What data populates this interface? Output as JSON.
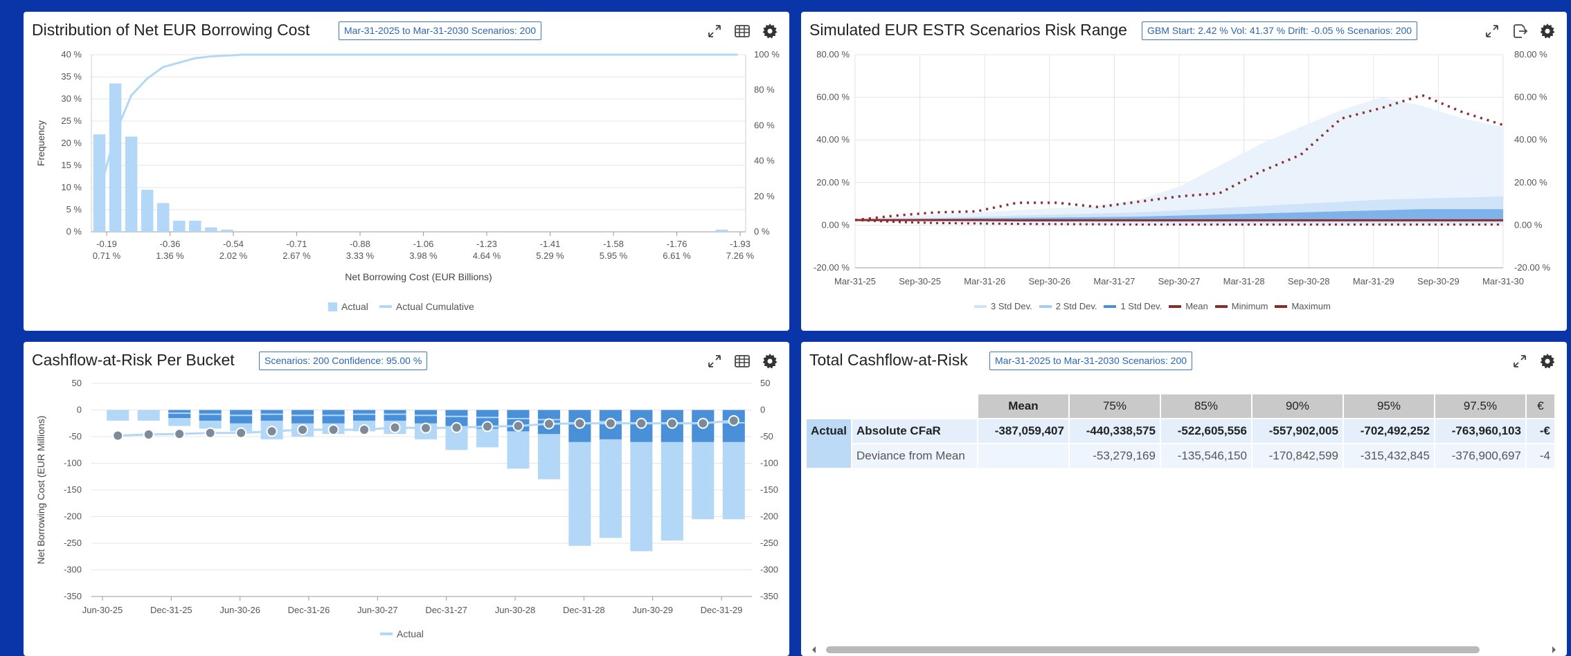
{
  "panel1": {
    "title": "Distribution of Net EUR Borrowing Cost",
    "badge": "Mar-31-2025 to Mar-31-2030 Scenarios: 200",
    "legend": {
      "actual": "Actual",
      "cumulative": "Actual Cumulative"
    },
    "icons": [
      "expand-icon",
      "table-icon",
      "gear-icon"
    ]
  },
  "panel2": {
    "title": "Simulated EUR ESTR Scenarios Risk Range",
    "badge": "GBM Start: 2.42 % Vol: 41.37 % Drift: -0.05 % Scenarios: 200",
    "legend": [
      "3 Std Dev.",
      "2 Std Dev.",
      "1 Std Dev.",
      "Mean",
      "Minimum",
      "Maximum"
    ],
    "icons": [
      "expand-icon",
      "export-icon",
      "gear-icon"
    ]
  },
  "panel3": {
    "title": "Cashflow-at-Risk Per Bucket",
    "badge": "Scenarios: 200 Confidence: 95.00 %",
    "legend": {
      "actual": "Actual"
    },
    "icons": [
      "expand-icon",
      "table-icon",
      "gear-icon"
    ]
  },
  "panel4": {
    "title": "Total Cashflow-at-Risk",
    "badge": "Mar-31-2025 to Mar-31-2030 Scenarios: 200",
    "icons": [
      "expand-icon",
      "gear-icon"
    ],
    "table": {
      "columns": [
        "Mean",
        "75%",
        "85%",
        "90%",
        "95%",
        "97.5%",
        "€"
      ],
      "group_label": "Actual",
      "rows": [
        {
          "label": "Absolute CFaR",
          "values": [
            "-387,059,407",
            "-440,338,575",
            "-522,605,556",
            "-557,902,005",
            "-702,492,252",
            "-763,960,103",
            "-€"
          ]
        },
        {
          "label": "Deviance from Mean",
          "values": [
            "",
            "-53,279,169",
            "-135,546,150",
            "-170,842,599",
            "-315,432,845",
            "-376,900,697",
            "-4"
          ]
        }
      ]
    }
  },
  "colors": {
    "background": "#0a35a8",
    "bar": "#b3d7f7",
    "bar_dark": "#4a90d9",
    "bar_mid": "#7fb2e8",
    "max_line": "#8b2c2c",
    "badge": "#3b78c4"
  },
  "chart_data": [
    {
      "type": "bar",
      "title": "Distribution of Net EUR Borrowing Cost",
      "xlabel": "Net Borrowing Cost (EUR Billions)",
      "ylabel": "Frequency",
      "tick_labels_top": [
        "-0.19",
        "-0.36",
        "-0.54",
        "-0.71",
        "-0.88",
        "-1.06",
        "-1.23",
        "-1.41",
        "-1.58",
        "-1.76",
        "-1.93"
      ],
      "tick_labels_bottom": [
        "0.71 %",
        "1.36 %",
        "2.02 %",
        "2.67 %",
        "3.33 %",
        "3.98 %",
        "4.64 %",
        "5.29 %",
        "5.95 %",
        "6.61 %",
        "7.26 %"
      ],
      "y_ticks": [
        "40 %",
        "35 %",
        "30 %",
        "25 %",
        "20 %",
        "15 %",
        "10 %",
        "5 %",
        "0 %"
      ],
      "y2_ticks": [
        "100 %",
        "80 %",
        "60 %",
        "40 %",
        "20 %",
        "0 %"
      ],
      "ylim": [
        0,
        40
      ],
      "y2lim": [
        0,
        100
      ],
      "series": [
        {
          "name": "Actual",
          "values": [
            22.0,
            33.5,
            21.5,
            9.5,
            6.5,
            2.5,
            2.5,
            1.0,
            0.5,
            0,
            0,
            0,
            0,
            0,
            0,
            0,
            0,
            0,
            0,
            0,
            0,
            0,
            0,
            0,
            0,
            0,
            0,
            0,
            0,
            0,
            0,
            0,
            0,
            0,
            0,
            0,
            0,
            0,
            0,
            0.5,
            0
          ]
        },
        {
          "name": "Actual Cumulative",
          "values": [
            22,
            55.5,
            77,
            86.5,
            93,
            95.5,
            98,
            99,
            99.5,
            100,
            100,
            100,
            100,
            100,
            100,
            100,
            100,
            100,
            100,
            100,
            100,
            100,
            100,
            100,
            100,
            100,
            100,
            100,
            100,
            100,
            100,
            100,
            100,
            100,
            100,
            100,
            100,
            100,
            100,
            100,
            100
          ]
        }
      ],
      "grid": true,
      "legend": "bottom"
    },
    {
      "type": "area",
      "title": "Simulated EUR ESTR Scenarios Risk Range",
      "x": [
        "Mar-31-25",
        "Sep-30-25",
        "Mar-31-26",
        "Sep-30-26",
        "Mar-31-27",
        "Sep-30-27",
        "Mar-31-28",
        "Sep-30-28",
        "Mar-31-29",
        "Sep-30-29",
        "Mar-31-30"
      ],
      "y_ticks": [
        "80.00 %",
        "60.00 %",
        "40.00 %",
        "20.00 %",
        "0.00 %",
        "-20.00 %"
      ],
      "ylim": [
        -20,
        80
      ],
      "series": [
        {
          "name": "3 Std Dev.",
          "upper": [
            3,
            4,
            5,
            6,
            7,
            8,
            9,
            12,
            18,
            28,
            38,
            46,
            54,
            60,
            56,
            50,
            46
          ],
          "lower": [
            2,
            1.5,
            1,
            0.5,
            0.5,
            0,
            0,
            0,
            0,
            0,
            0,
            0,
            0,
            0,
            0,
            0,
            0
          ]
        },
        {
          "name": "2 Std Dev.",
          "upper": [
            2.8,
            3.2,
            3.5,
            4,
            4.5,
            5,
            5.5,
            6,
            7,
            8,
            9,
            10,
            11,
            12,
            12.5,
            13,
            13.5
          ],
          "lower": [
            2.2,
            2,
            1.8,
            1.6,
            1.5,
            1.4,
            1.3,
            1.2,
            1.1,
            1,
            1,
            1,
            1,
            1,
            1,
            1,
            1
          ]
        },
        {
          "name": "1 Std Dev.",
          "upper": [
            2.6,
            2.8,
            3,
            3.2,
            3.4,
            3.6,
            3.8,
            4,
            4.5,
            5,
            5.5,
            6,
            6.5,
            7,
            7.5,
            7.5,
            7.5
          ],
          "lower": [
            2.4,
            2.3,
            2.2,
            2.1,
            2,
            2,
            2,
            2,
            2,
            2,
            2,
            2,
            2,
            2,
            2,
            2,
            2
          ]
        },
        {
          "name": "Mean",
          "values": [
            2.4,
            2.4,
            2.4,
            2.4,
            2.3,
            2.3,
            2.3,
            2.3,
            2.3,
            2.3,
            2.3,
            2.3,
            2.3,
            2.3,
            2.3,
            2.3,
            2.3
          ]
        },
        {
          "name": "Minimum",
          "values": [
            2.4,
            1.5,
            1.0,
            0.8,
            0.6,
            0.5,
            0.4,
            0.3,
            0.3,
            0.3,
            0.3,
            0.3,
            0.3,
            0.3,
            0.3,
            0.3,
            0.3
          ]
        },
        {
          "name": "Maximum",
          "values": [
            2.4,
            4.5,
            6.0,
            6.5,
            10.5,
            10.5,
            8.5,
            11.0,
            13.5,
            15.0,
            25.0,
            33.0,
            50.0,
            55.0,
            61.0,
            53.0,
            47.0
          ]
        }
      ],
      "legend": "bottom"
    },
    {
      "type": "bar",
      "title": "Cashflow-at-Risk Per Bucket",
      "ylabel": "Net Borrowing Cost (EUR Millions)",
      "x": [
        "Jun-30-25",
        "Dec-31-25",
        "Jun-30-26",
        "Dec-31-26",
        "Jun-30-27",
        "Dec-31-27",
        "Jun-30-28",
        "Dec-31-28",
        "Jun-30-29",
        "Dec-31-29"
      ],
      "y_ticks": [
        "50",
        "0",
        "-50",
        "-100",
        "-150",
        "-200",
        "-250",
        "-300",
        "-350"
      ],
      "ylim": [
        -350,
        50
      ],
      "series": [
        {
          "name": "Actual",
          "mean": [
            -48,
            -46,
            -45,
            -43,
            -43,
            -40,
            -37,
            -37,
            -37,
            -33,
            -34,
            -33,
            -31,
            -30,
            -26,
            -25,
            -25,
            -25,
            -25,
            -25,
            -20
          ],
          "p_light": [
            -20,
            -20,
            -30,
            -35,
            -40,
            -55,
            -50,
            -45,
            -40,
            -45,
            -55,
            -75,
            -70,
            -110,
            -130,
            -255,
            -240,
            -265,
            -245,
            -205,
            -205
          ],
          "p_dark": [
            0,
            0,
            -15,
            -20,
            -25,
            -20,
            -25,
            -25,
            -20,
            -20,
            -25,
            -30,
            -35,
            -40,
            -45,
            -60,
            -55,
            -60,
            -60,
            -60,
            -60
          ]
        }
      ],
      "legend": "bottom"
    }
  ]
}
